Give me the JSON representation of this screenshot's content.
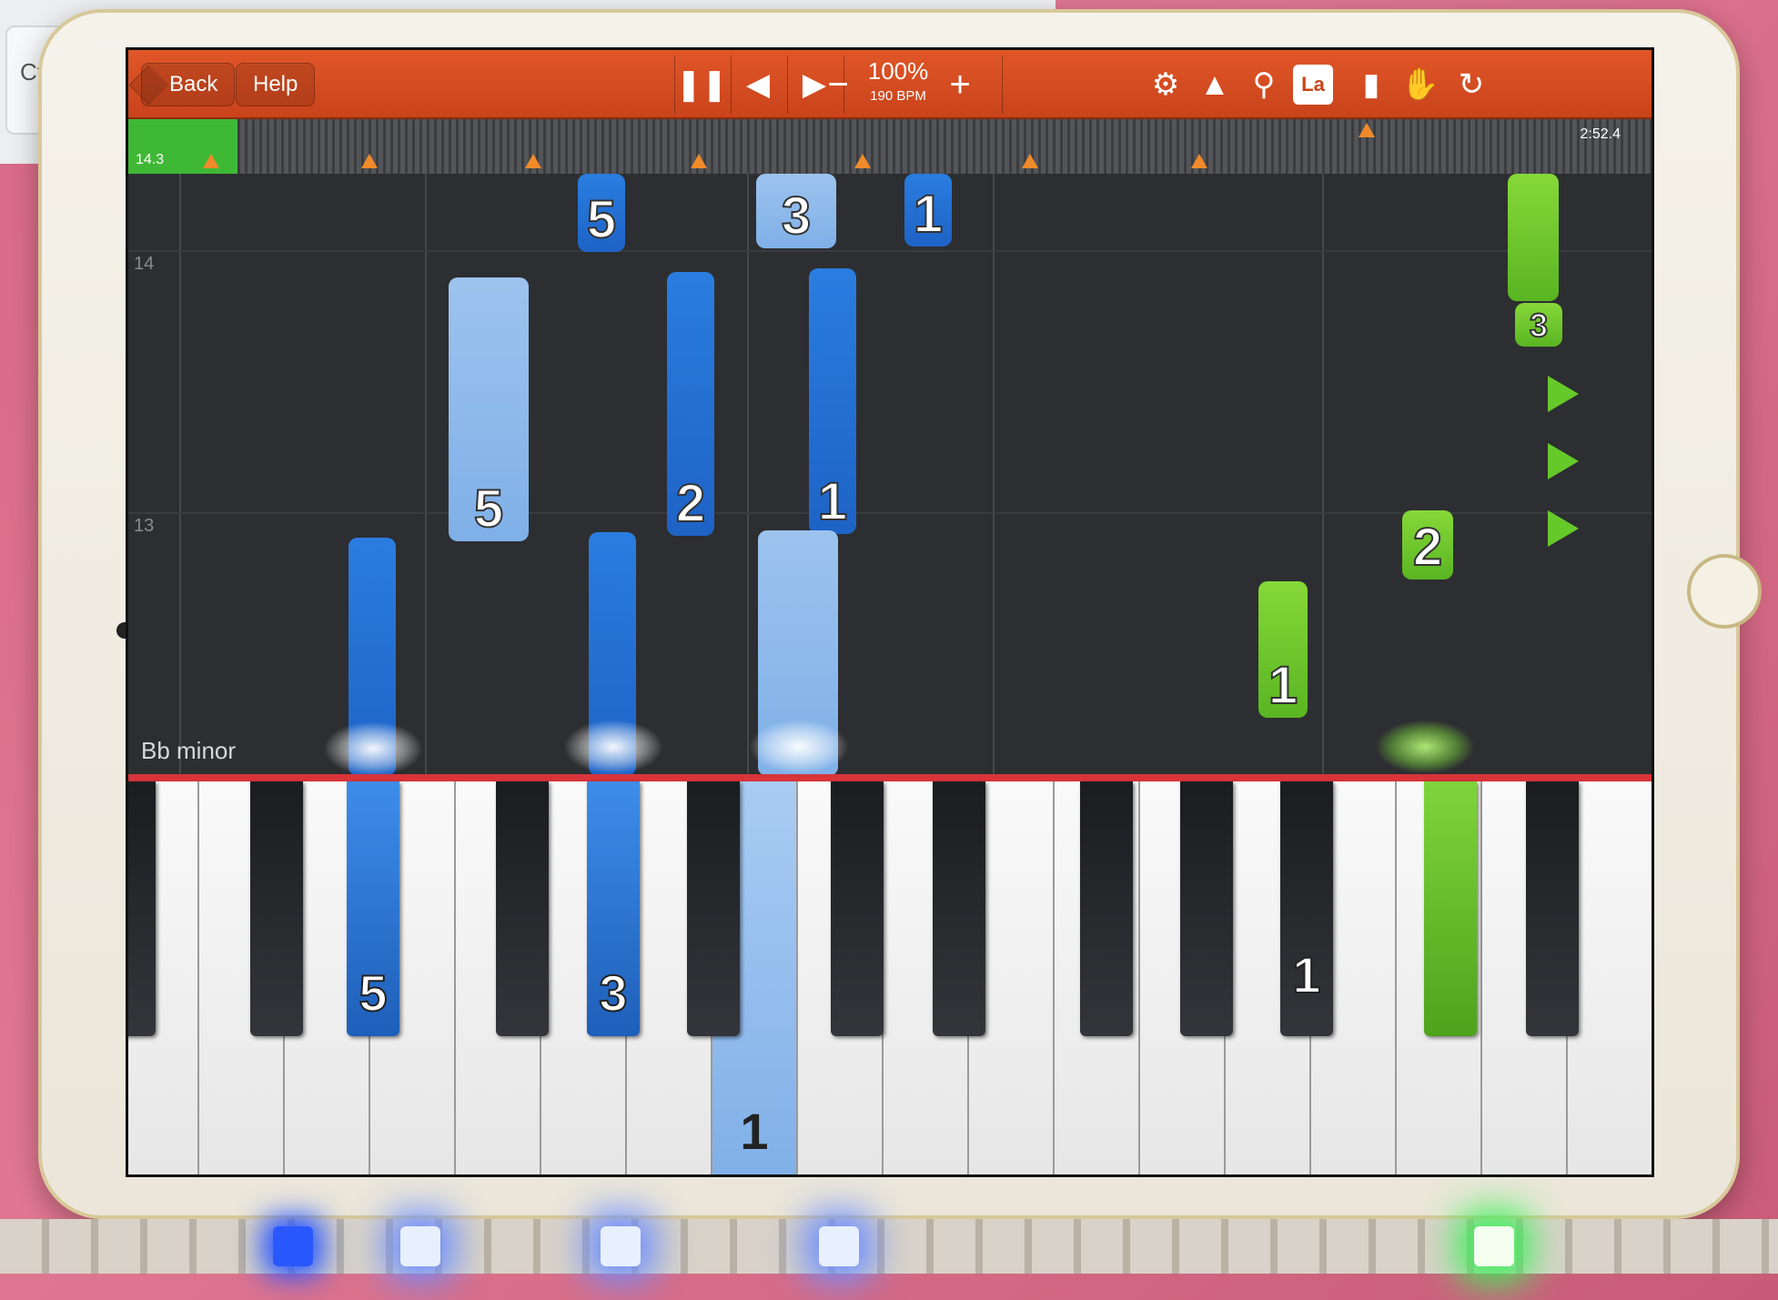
{
  "keyboard": {
    "ctrl_label": "Ctrl"
  },
  "toolbar": {
    "back_label": "Back",
    "help_label": "Help",
    "tempo_percent": "100%",
    "tempo_bpm": "190 BPM",
    "la_label": "La",
    "icons": [
      "pause-icon",
      "skip-back-icon",
      "skip-forward-icon",
      "minus-icon",
      "plus-icon",
      "gear-icon",
      "metronome-icon",
      "magnifier-icon",
      "la-icon",
      "bookmark-icon",
      "hand-icon",
      "loop-icon"
    ]
  },
  "timeline": {
    "start_label": "14.3",
    "end_label": "2:52.4",
    "progress_fraction": 0.07
  },
  "roll": {
    "measure_labels": [
      "14",
      "13"
    ],
    "key_signature": "Bb minor",
    "notes": [
      {
        "finger": "5"
      },
      {
        "finger": "3"
      },
      {
        "finger": "1"
      },
      {
        "finger": "5"
      },
      {
        "finger": "2"
      },
      {
        "finger": "1"
      },
      {
        "finger": ""
      },
      {
        "finger": ""
      },
      {
        "finger": ""
      },
      {
        "finger": "1"
      },
      {
        "finger": "2"
      },
      {
        "finger": "3"
      }
    ]
  },
  "piano": {
    "key_fingers": {
      "left_black": "5",
      "mid_black": "3",
      "white_pressed": "1",
      "right_black": "1"
    }
  },
  "colors": {
    "toolbar": "#d24c22",
    "right_hand": "#2a7de0",
    "right_hand_light": "#8fbaec",
    "left_hand": "#6cc62c",
    "keyboard_line": "#d8343a"
  }
}
